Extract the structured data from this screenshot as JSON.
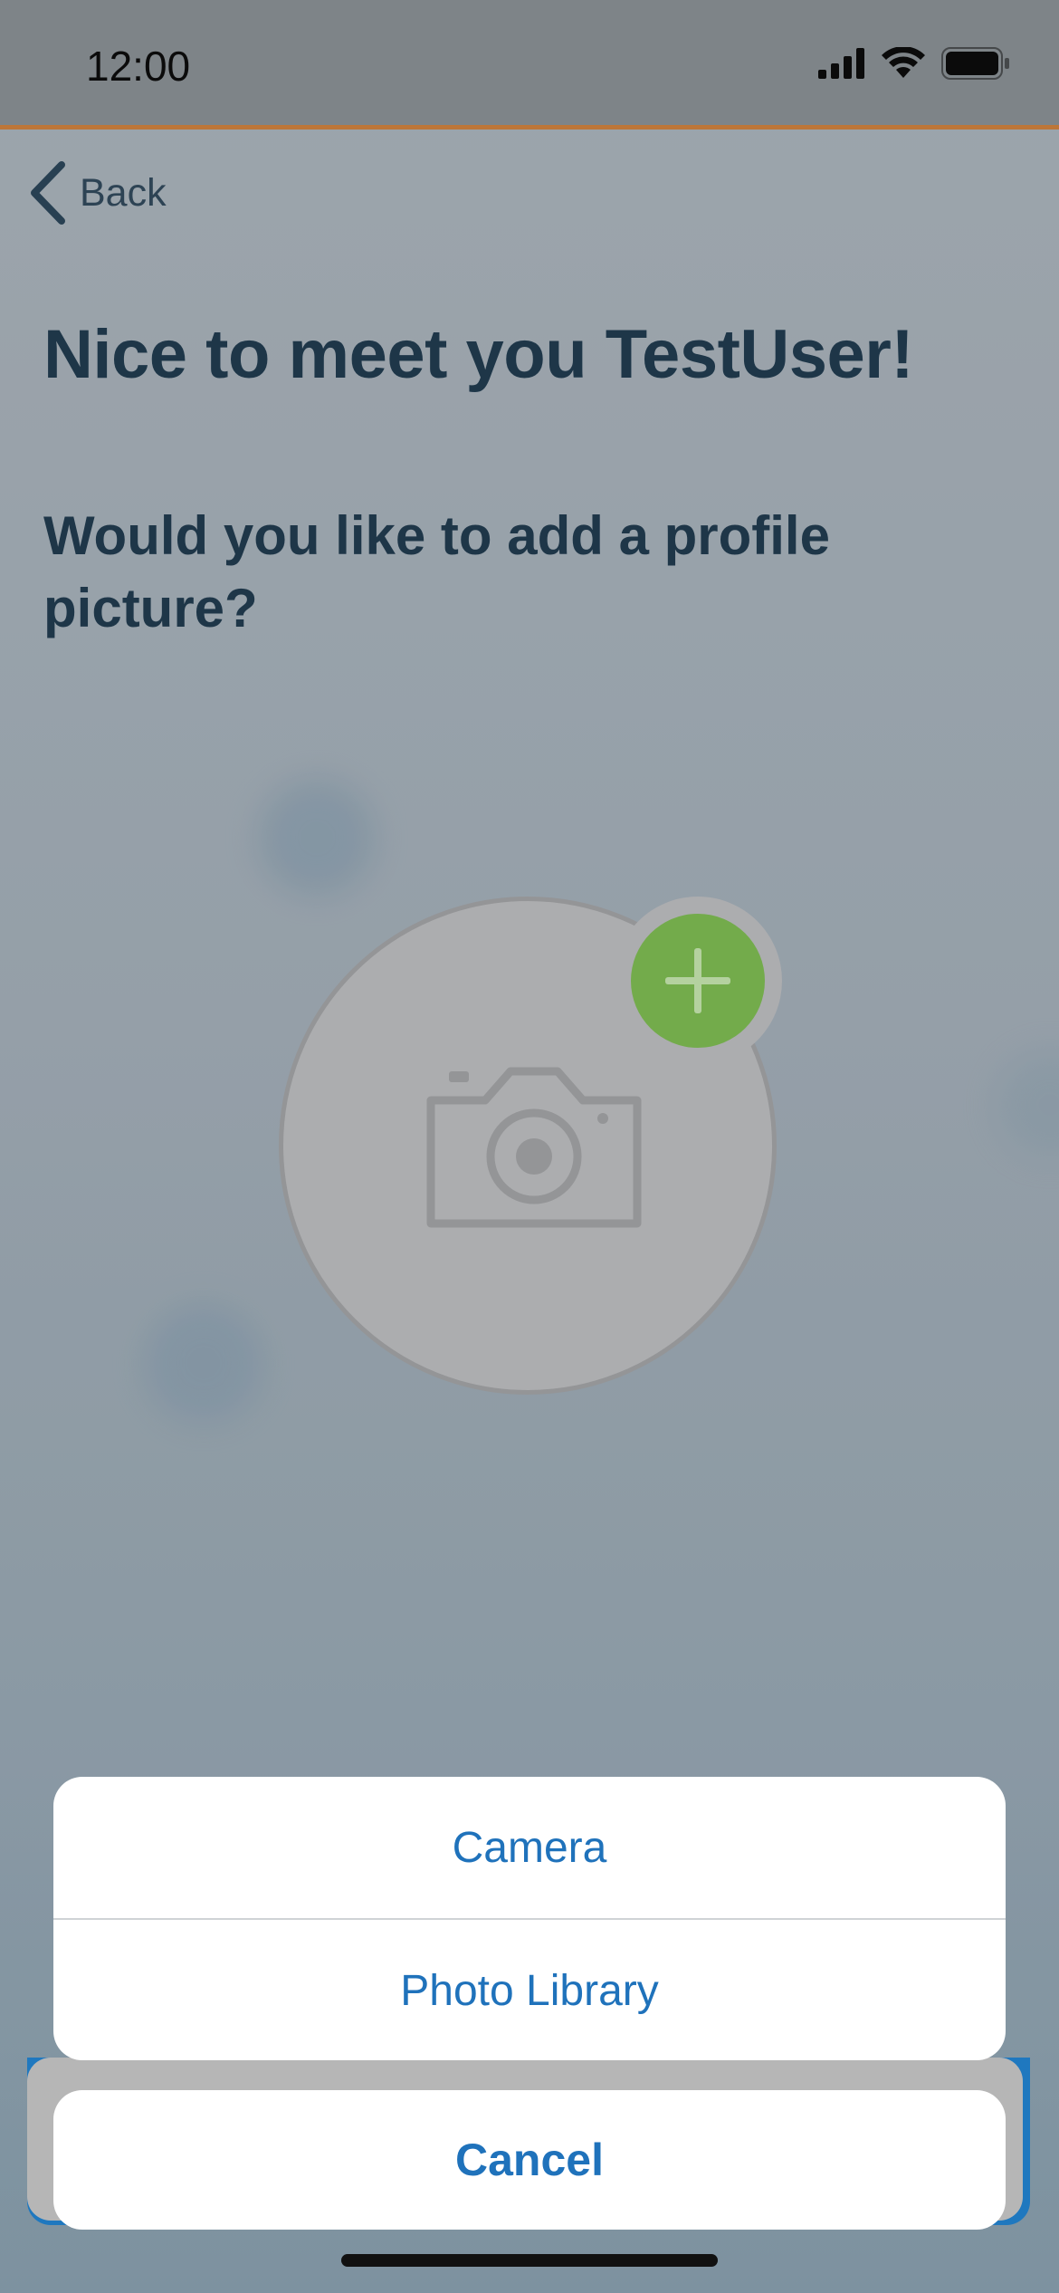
{
  "status_bar": {
    "time": "12:00",
    "icons": [
      "signal-icon",
      "wifi-icon",
      "battery-icon"
    ]
  },
  "nav": {
    "back_label": "Back"
  },
  "main": {
    "title": "Nice to meet you TestUser!",
    "subtitle": "Would you like to add a profile picture?",
    "avatar_icon": "camera-icon",
    "add_icon": "plus-icon"
  },
  "action_sheet": {
    "options": [
      {
        "label": "Camera"
      },
      {
        "label": "Photo Library"
      }
    ],
    "cancel_label": "Cancel"
  },
  "colors": {
    "accent": "#1f72bb",
    "add_button": "#72b340",
    "status_border": "#c9752a",
    "title_text": "#0f2a3d"
  }
}
